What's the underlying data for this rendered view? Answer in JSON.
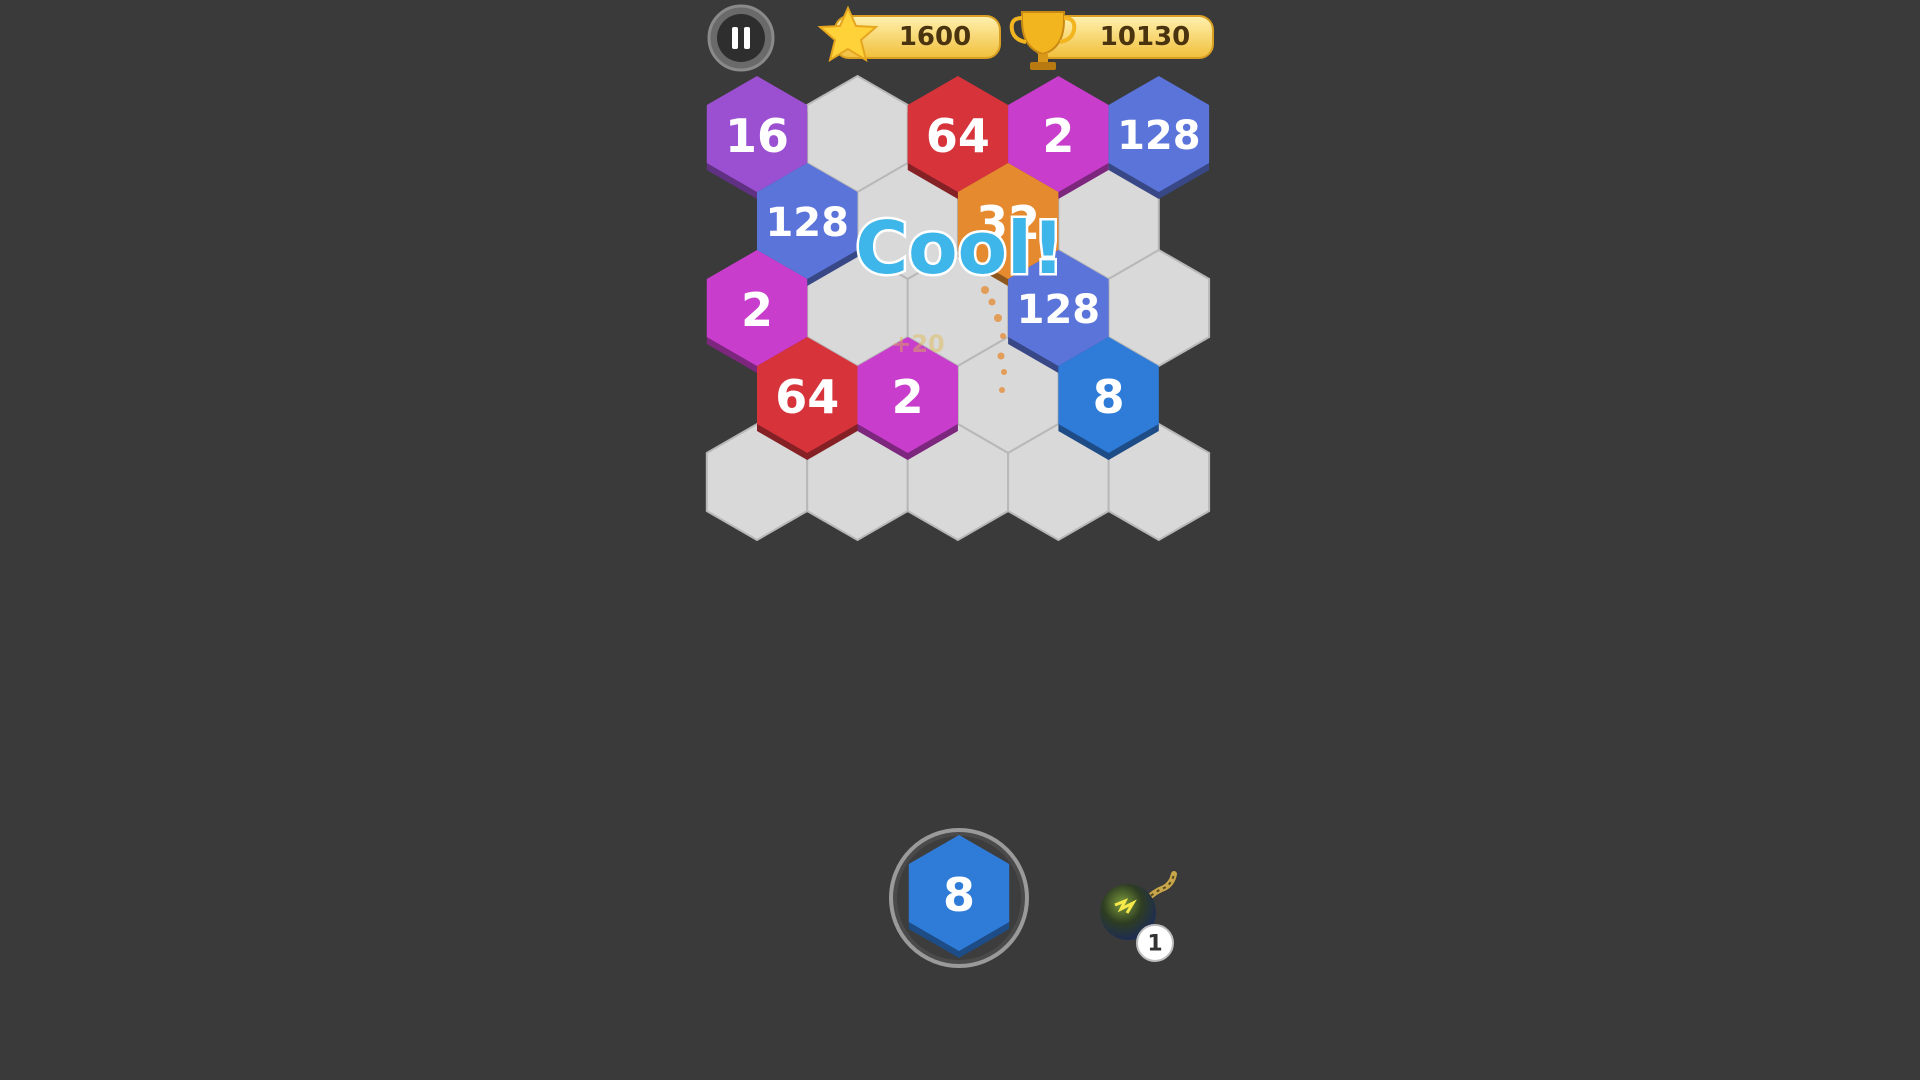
{
  "hud": {
    "stars": "1600",
    "trophies": "10130"
  },
  "board": {
    "cells": [
      {
        "row": 0,
        "col": 0,
        "value": "16",
        "color": "#9b4fd1"
      },
      {
        "row": 0,
        "col": 1,
        "value": "",
        "color": ""
      },
      {
        "row": 0,
        "col": 2,
        "value": "64",
        "color": "#d6333b"
      },
      {
        "row": 0,
        "col": 3,
        "value": "2",
        "color": "#c83dcc"
      },
      {
        "row": 0,
        "col": 4,
        "value": "128",
        "color": "#5b74d9"
      },
      {
        "row": 1,
        "col": 0,
        "value": "128",
        "color": "#5b74d9"
      },
      {
        "row": 1,
        "col": 1,
        "value": "",
        "color": ""
      },
      {
        "row": 1,
        "col": 2,
        "value": "32",
        "color": "#e58a2e"
      },
      {
        "row": 1,
        "col": 3,
        "value": "",
        "color": ""
      },
      {
        "row": 2,
        "col": 0,
        "value": "2",
        "color": "#c83dcc"
      },
      {
        "row": 2,
        "col": 1,
        "value": "",
        "color": ""
      },
      {
        "row": 2,
        "col": 2,
        "value": "",
        "color": ""
      },
      {
        "row": 2,
        "col": 3,
        "value": "128",
        "color": "#5b74d9"
      },
      {
        "row": 2,
        "col": 4,
        "value": "",
        "color": ""
      },
      {
        "row": 3,
        "col": 0,
        "value": "64",
        "color": "#d6333b"
      },
      {
        "row": 3,
        "col": 1,
        "value": "2",
        "color": "#c83dcc"
      },
      {
        "row": 3,
        "col": 2,
        "value": "",
        "color": ""
      },
      {
        "row": 3,
        "col": 3,
        "value": "8",
        "color": "#2f7bd8"
      },
      {
        "row": 4,
        "col": 0,
        "value": "",
        "color": ""
      },
      {
        "row": 4,
        "col": 1,
        "value": "",
        "color": ""
      },
      {
        "row": 4,
        "col": 2,
        "value": "",
        "color": ""
      },
      {
        "row": 4,
        "col": 3,
        "value": "",
        "color": ""
      },
      {
        "row": 4,
        "col": 4,
        "value": "",
        "color": ""
      }
    ]
  },
  "popup": {
    "text": "Cool!",
    "score_ghost": "+20"
  },
  "next_tile": {
    "value": "8",
    "color": "#2f7bd8"
  },
  "bomb": {
    "count": "1"
  },
  "colors": {
    "background": "#3a3a3a",
    "empty_cell": "#d9d9d9",
    "pill": "#f7cf5a"
  }
}
